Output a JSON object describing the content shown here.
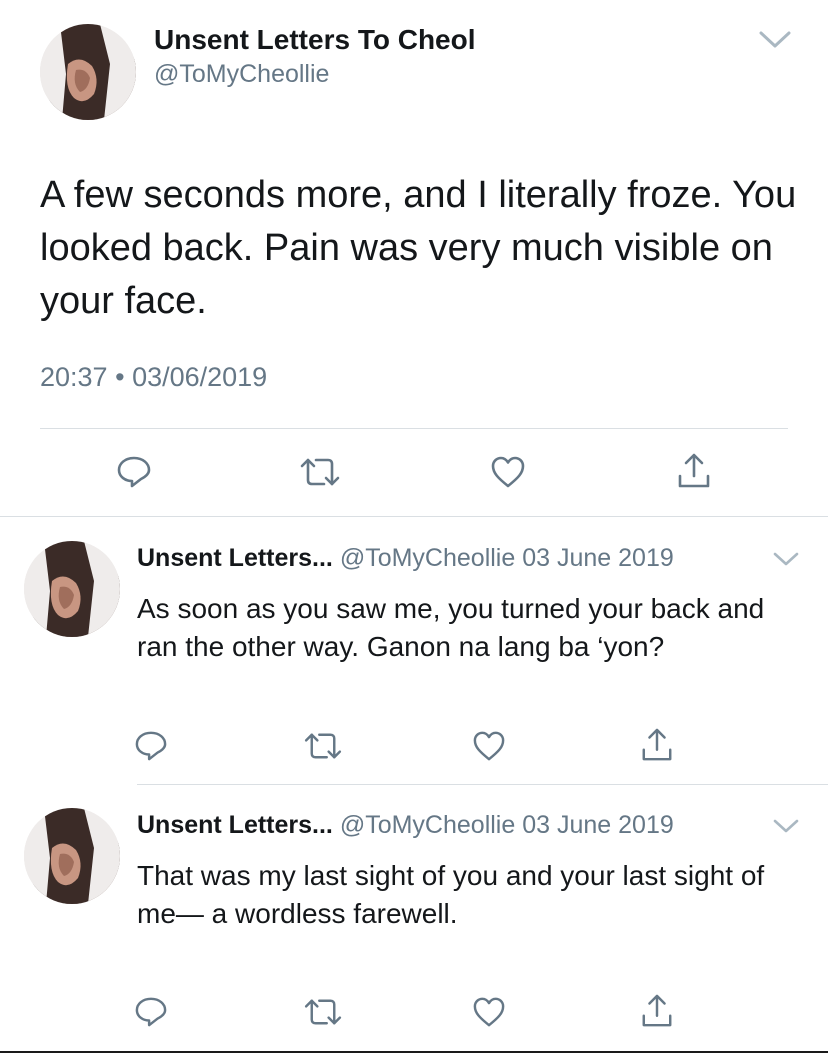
{
  "main_tweet": {
    "display_name": "Unsent Letters To Cheol",
    "handle": "@ToMyCheollie",
    "text": "A few seconds more, and I literally froze. You looked back. Pain was very much visible on your face.",
    "time": "20:37",
    "separator": "•",
    "date": "03/06/2019",
    "actions": [
      "reply-icon",
      "retweet-icon",
      "like-icon",
      "share-icon"
    ]
  },
  "replies": [
    {
      "display_name": "Unsent Letters...",
      "handle": "@ToMyCheollie",
      "date": "03 June 2019",
      "text": "As soon as you saw me, you turned your back and ran the other way. Ganon na lang ba ‘yon?"
    },
    {
      "display_name": "Unsent Letters...",
      "handle": "@ToMyCheollie",
      "date": "03 June 2019",
      "text": "That was my last sight of you and your last sight of me— a wordless farewell."
    }
  ],
  "colors": {
    "text": "#14171a",
    "secondary": "#657786",
    "divider": "#dadfe3",
    "icon": "#657786"
  }
}
